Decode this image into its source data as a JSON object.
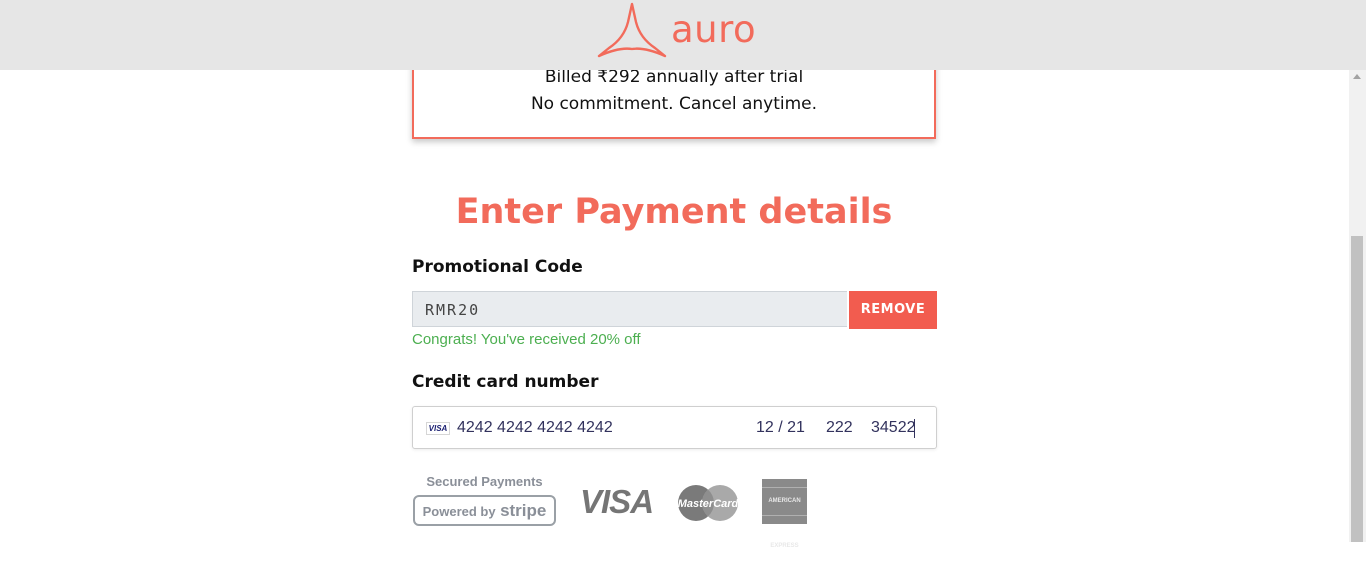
{
  "brand": {
    "name": "auro",
    "color": "#f26b5b"
  },
  "plan": {
    "billing_note": "Billed ₹292 annually after trial",
    "commitment_note": "No commitment. Cancel anytime."
  },
  "payment": {
    "heading": "Enter Payment details",
    "promo": {
      "label": "Promotional Code",
      "value": "RMR20",
      "remove_label": "REMOVE",
      "success_message": "Congrats! You've received 20% off",
      "success_color": "#4caf50"
    },
    "card": {
      "label": "Credit card number",
      "brand_icon": "VISA",
      "number": "4242 4242 4242 4242",
      "expiry": "12 / 21",
      "cvc": "222",
      "zip": "34522"
    },
    "badges": {
      "secured_text": "Secured Payments",
      "powered_by": "Powered by",
      "stripe": "stripe",
      "visa": "VISA",
      "mastercard": "MasterCard",
      "amex": "AMERICAN EXPRESS"
    }
  }
}
